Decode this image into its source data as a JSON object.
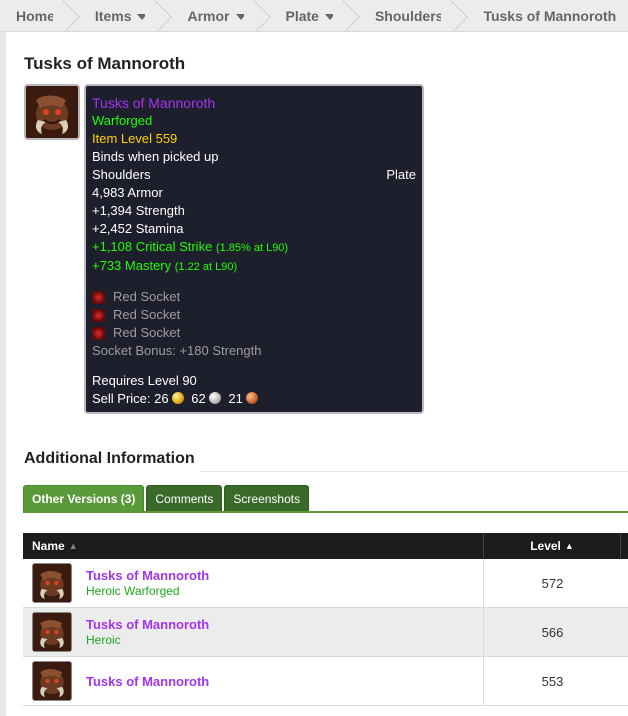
{
  "breadcrumb": {
    "items": [
      {
        "label": "Home",
        "dropdown": false
      },
      {
        "label": "Items",
        "dropdown": true
      },
      {
        "label": "Armor",
        "dropdown": true
      },
      {
        "label": "Plate",
        "dropdown": true
      },
      {
        "label": "Shoulders",
        "dropdown": false
      },
      {
        "label": "Tusks of Mannoroth",
        "dropdown": false
      }
    ]
  },
  "page": {
    "title": "Tusks of Mannoroth"
  },
  "item_icon": "tusks-of-mannoroth-icon",
  "tooltip": {
    "name": "Tusks of Mannoroth",
    "forge": "Warforged",
    "item_level": "Item Level 559",
    "binding": "Binds when picked up",
    "slot": "Shoulders",
    "type": "Plate",
    "armor": "4,983 Armor",
    "strength": "+1,394 Strength",
    "stamina": "+2,452 Stamina",
    "crit": "+1,108 Critical Strike",
    "crit_note": "(1.85% at L90)",
    "mastery": "+733 Mastery",
    "mastery_note": "(1.22 at L90)",
    "sockets": [
      "Red Socket",
      "Red Socket",
      "Red Socket"
    ],
    "socket_bonus": "Socket Bonus: +180 Strength",
    "requires": "Requires Level 90",
    "sell_label": "Sell Price:",
    "sell_gold": "26",
    "sell_silver": "62",
    "sell_copper": "21",
    "colors": {
      "epic": "#a335ee",
      "uncommon": "#1eff00",
      "item_level": "#ffd100",
      "inactive": "#9d9d9d"
    }
  },
  "additional": {
    "heading": "Additional Information"
  },
  "tabs": [
    {
      "label": "Other Versions (3)",
      "active": true
    },
    {
      "label": "Comments",
      "active": false
    },
    {
      "label": "Screenshots",
      "active": false
    }
  ],
  "table": {
    "headers": {
      "name": "Name",
      "level": "Level"
    },
    "rows": [
      {
        "name": "Tusks of Mannoroth",
        "sub": "Heroic Warforged",
        "level": "572"
      },
      {
        "name": "Tusks of Mannoroth",
        "sub": "Heroic",
        "level": "566"
      },
      {
        "name": "Tusks of Mannoroth",
        "sub": "",
        "level": "553"
      }
    ]
  }
}
